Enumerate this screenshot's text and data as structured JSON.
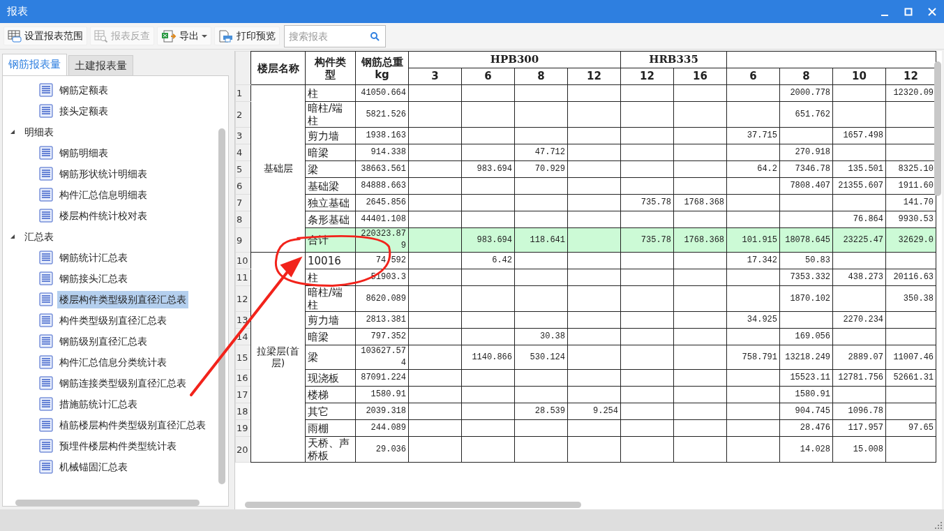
{
  "window": {
    "title": "报表"
  },
  "toolbar": {
    "buttons": [
      {
        "kind": "range",
        "label": "设置报表范围",
        "disabled": false
      },
      {
        "kind": "lookup",
        "label": "报表反查",
        "disabled": true
      },
      {
        "kind": "export",
        "label": "导出",
        "disabled": false
      },
      {
        "kind": "print",
        "label": "打印预览",
        "disabled": false
      }
    ],
    "search": {
      "placeholder": "搜索报表"
    }
  },
  "tabs": [
    {
      "label": "钢筋报表量",
      "selected": true
    },
    {
      "label": "土建报表量",
      "selected": false
    }
  ],
  "tree": [
    {
      "label": "钢筋定额表",
      "selected": false
    },
    {
      "label": "接头定额表",
      "selected": false
    },
    {
      "label": "明细表",
      "expanded": true,
      "children": [
        {
          "label": "钢筋明细表",
          "selected": false
        },
        {
          "label": "钢筋形状统计明细表",
          "selected": false
        },
        {
          "label": "构件汇总信息明细表",
          "selected": false
        },
        {
          "label": "楼层构件统计校对表",
          "selected": false
        }
      ]
    },
    {
      "label": "汇总表",
      "expanded": true,
      "children": [
        {
          "label": "钢筋统计汇总表",
          "selected": false
        },
        {
          "label": "钢筋接头汇总表",
          "selected": false
        },
        {
          "label": "楼层构件类型级别直径汇总表",
          "selected": true
        },
        {
          "label": "构件类型级别直径汇总表",
          "selected": false
        },
        {
          "label": "钢筋级别直径汇总表",
          "selected": false
        },
        {
          "label": "构件汇总信息分类统计表",
          "selected": false
        },
        {
          "label": "钢筋连接类型级别直径汇总表",
          "selected": false
        },
        {
          "label": "措施筋统计汇总表",
          "selected": false
        },
        {
          "label": "植筋楼层构件类型级别直径汇总表",
          "selected": false
        },
        {
          "label": "预埋件楼层构件类型统计表",
          "selected": false
        },
        {
          "label": "机械锚固汇总表",
          "selected": false
        }
      ]
    }
  ],
  "table": {
    "columns": [
      "楼层名称",
      "构件类型",
      "钢筋总重kg"
    ],
    "grade_groups": [
      {
        "label": "HPB300",
        "diameters": [
          "3",
          "6",
          "8",
          "12"
        ]
      },
      {
        "label": "HRB335",
        "diameters": [
          "12",
          "16"
        ]
      },
      {
        "diameters": [
          "6",
          "8",
          "10",
          "12"
        ]
      }
    ],
    "floors": [
      {
        "name": "基础层",
        "rows": [
          {
            "num": "1",
            "type": "柱",
            "total": "41050.664",
            "highlighted": false,
            "grades": {
              "2": {
                "8": "2000.778",
                "12": "12320.09"
              }
            }
          },
          {
            "num": "2",
            "type": "暗柱/端柱",
            "total": "5821.526",
            "highlighted": false,
            "grades": {
              "2": {
                "8": "651.762"
              }
            }
          },
          {
            "num": "3",
            "type": "剪力墙",
            "total": "1938.163",
            "highlighted": false,
            "grades": {
              "2": {
                "6": "37.715",
                "10": "1657.498"
              }
            }
          },
          {
            "num": "4",
            "type": "暗梁",
            "total": "914.338",
            "highlighted": false,
            "grades": {
              "0": {
                "8": "47.712"
              },
              "2": {
                "8": "270.918"
              }
            }
          },
          {
            "num": "5",
            "type": "梁",
            "total": "38663.561",
            "highlighted": false,
            "grades": {
              "0": {
                "6": "983.694",
                "8": "70.929"
              },
              "2": {
                "6": "64.2",
                "8": "7346.78",
                "10": "135.501",
                "12": "8325.10"
              }
            }
          },
          {
            "num": "6",
            "type": "基础梁",
            "total": "84888.663",
            "highlighted": false,
            "grades": {
              "2": {
                "8": "7808.407",
                "10": "21355.607",
                "12": "1911.60"
              }
            }
          },
          {
            "num": "7",
            "type": "独立基础",
            "total": "2645.856",
            "highlighted": false,
            "grades": {
              "1": {
                "12": "735.78",
                "16": "1768.368"
              },
              "2": {
                "12": "141.70"
              }
            }
          },
          {
            "num": "8",
            "type": "条形基础",
            "total": "44401.108",
            "highlighted": false,
            "grades": {
              "2": {
                "10": "76.864",
                "12": "9930.53"
              }
            }
          },
          {
            "num": "9",
            "type": "合计",
            "total": "220323.879",
            "highlighted": true,
            "grades": {
              "0": {
                "6": "983.694",
                "8": "118.641"
              },
              "1": {
                "12": "735.78",
                "16": "1768.368"
              },
              "2": {
                "6": "101.915",
                "8": "18078.645",
                "10": "23225.47",
                "12": "32629.0"
              }
            }
          }
        ]
      },
      {
        "name": "拉梁层(首层)",
        "rows": [
          {
            "num": "10",
            "type": "10016",
            "total": "74.592",
            "highlighted": false,
            "grades": {
              "0": {
                "6": "6.42"
              },
              "2": {
                "6": "17.342",
                "8": "50.83"
              }
            }
          },
          {
            "num": "11",
            "type": "柱",
            "total": "51903.3",
            "highlighted": false,
            "grades": {
              "2": {
                "8": "7353.332",
                "10": "438.273",
                "12": "20116.63"
              }
            }
          },
          {
            "num": "12",
            "type": "暗柱/端柱",
            "total": "8620.089",
            "highlighted": false,
            "grades": {
              "2": {
                "8": "1870.102",
                "12": "350.38"
              }
            }
          },
          {
            "num": "13",
            "type": "剪力墙",
            "total": "2813.381",
            "highlighted": false,
            "grades": {
              "2": {
                "6": "34.925",
                "10": "2270.234"
              }
            }
          },
          {
            "num": "14",
            "type": "暗梁",
            "total": "797.352",
            "highlighted": false,
            "grades": {
              "0": {
                "8": "30.38"
              },
              "2": {
                "8": "169.056"
              }
            }
          },
          {
            "num": "15",
            "type": "梁",
            "total": "103627.574",
            "highlighted": false,
            "grades": {
              "0": {
                "6": "1140.866",
                "8": "530.124"
              },
              "2": {
                "6": "758.791",
                "8": "13218.249",
                "10": "2889.07",
                "12": "11007.46"
              }
            }
          },
          {
            "num": "16",
            "type": "现浇板",
            "total": "87091.224",
            "highlighted": false,
            "grades": {
              "2": {
                "8": "15523.11",
                "10": "12781.756",
                "12": "52661.31"
              }
            }
          },
          {
            "num": "17",
            "type": "楼梯",
            "total": "1580.91",
            "highlighted": false,
            "grades": {
              "2": {
                "8": "1580.91"
              }
            }
          },
          {
            "num": "18",
            "type": "其它",
            "total": "2039.318",
            "highlighted": false,
            "grades": {
              "0": {
                "8": "28.539",
                "12": "9.254"
              },
              "2": {
                "8": "904.745",
                "10": "1096.78"
              }
            }
          },
          {
            "num": "19",
            "type": "雨棚",
            "total": "244.089",
            "highlighted": false,
            "grades": {
              "2": {
                "8": "28.476",
                "10": "117.957",
                "12": "97.65"
              }
            }
          },
          {
            "num": "20",
            "type": "天桥、声桥板",
            "total": "29.036",
            "highlighted": false,
            "grades": {
              "2": {
                "8": "14.028",
                "10": "15.008"
              }
            }
          }
        ]
      }
    ]
  }
}
